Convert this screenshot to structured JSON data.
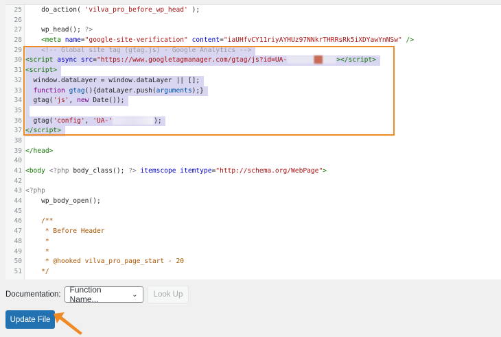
{
  "editor": {
    "lines": [
      {
        "n": "25",
        "sel": false,
        "tokens": [
          [
            "",
            "    do_action( "
          ],
          [
            "str",
            "'vilva_pro_before_wp_head'"
          ],
          [
            "",
            " );"
          ]
        ]
      },
      {
        "n": "26",
        "sel": false,
        "tokens": []
      },
      {
        "n": "27",
        "sel": false,
        "tokens": [
          [
            "",
            "    wp_head(); "
          ],
          [
            "php",
            "?>"
          ]
        ]
      },
      {
        "n": "28",
        "sel": false,
        "tokens": [
          [
            "",
            "    "
          ],
          [
            "tag",
            "<meta "
          ],
          [
            "attr",
            "name"
          ],
          [
            "",
            "="
          ],
          [
            "str",
            "\"google-site-verification\""
          ],
          [
            "",
            " "
          ],
          [
            "attr",
            "content"
          ],
          [
            "",
            "="
          ],
          [
            "str",
            "\"iaUHfvCY11riyAYHUz97NNkrTHRRsRk5iXDYawYnNSw\""
          ],
          [
            "tag",
            " />"
          ]
        ]
      },
      {
        "n": "29",
        "sel": true,
        "tokens": [
          [
            "com",
            "    <!-- Global site tag (gtag.js) - Google Analytics -->"
          ]
        ]
      },
      {
        "n": "30",
        "sel": true,
        "tokens": [
          [
            "tag",
            "<script "
          ],
          [
            "attr",
            "async src"
          ],
          [
            "",
            "="
          ],
          [
            "str",
            "\"https://www.googletagmanager.com/gtag/js?id=UA-"
          ],
          [
            "blur-red",
            ""
          ],
          [
            "tag",
            "></script>"
          ]
        ]
      },
      {
        "n": "31",
        "sel": true,
        "tokens": [
          [
            "tag",
            "<script>"
          ]
        ]
      },
      {
        "n": "32",
        "sel": true,
        "tokens": [
          [
            "",
            "  window.dataLayer = window.dataLayer || [];"
          ]
        ]
      },
      {
        "n": "33",
        "sel": true,
        "tokens": [
          [
            "",
            "  "
          ],
          [
            "kw",
            "function"
          ],
          [
            "",
            " "
          ],
          [
            "var",
            "gtag"
          ],
          [
            "",
            "(){dataLayer.push("
          ],
          [
            "var",
            "arguments"
          ],
          [
            "",
            ");}"
          ]
        ]
      },
      {
        "n": "34",
        "sel": true,
        "tokens": [
          [
            "",
            "  gtag("
          ],
          [
            "str",
            "'js'"
          ],
          [
            "",
            ", "
          ],
          [
            "kw",
            "new"
          ],
          [
            "",
            " Date());"
          ]
        ]
      },
      {
        "n": "35",
        "sel": true,
        "tokens": [
          [
            "",
            ""
          ]
        ]
      },
      {
        "n": "36",
        "sel": true,
        "tokens": [
          [
            "",
            "  gtag("
          ],
          [
            "str",
            "'config'"
          ],
          [
            "",
            ", "
          ],
          [
            "str",
            "'UA-'"
          ],
          [
            "blur",
            ""
          ],
          [
            "",
            ");"
          ]
        ]
      },
      {
        "n": "37",
        "sel": true,
        "tokens": [
          [
            "tag",
            "</script>"
          ]
        ]
      },
      {
        "n": "38",
        "sel": false,
        "tokens": []
      },
      {
        "n": "39",
        "sel": false,
        "tokens": [
          [
            "tag",
            "</head>"
          ]
        ]
      },
      {
        "n": "40",
        "sel": false,
        "tokens": []
      },
      {
        "n": "41",
        "sel": false,
        "tokens": [
          [
            "tag",
            "<body "
          ],
          [
            "php",
            "<?php"
          ],
          [
            "",
            " body_class(); "
          ],
          [
            "php",
            "?>"
          ],
          [
            "",
            " "
          ],
          [
            "attr",
            "itemscope itemtype"
          ],
          [
            "",
            "="
          ],
          [
            "str",
            "\"http://schema.org/WebPage\""
          ],
          [
            "tag",
            ">"
          ]
        ]
      },
      {
        "n": "42",
        "sel": false,
        "tokens": []
      },
      {
        "n": "43",
        "sel": false,
        "tokens": [
          [
            "php",
            "<?php"
          ]
        ]
      },
      {
        "n": "44",
        "sel": false,
        "tokens": [
          [
            "",
            "    wp_body_open();"
          ]
        ]
      },
      {
        "n": "45",
        "sel": false,
        "tokens": []
      },
      {
        "n": "46",
        "sel": false,
        "tokens": [
          [
            "doc",
            "    /**"
          ]
        ]
      },
      {
        "n": "47",
        "sel": false,
        "tokens": [
          [
            "doc",
            "     * Before Header"
          ]
        ]
      },
      {
        "n": "48",
        "sel": false,
        "tokens": [
          [
            "doc",
            "     *"
          ]
        ]
      },
      {
        "n": "49",
        "sel": false,
        "tokens": [
          [
            "doc",
            "     *"
          ]
        ]
      },
      {
        "n": "50",
        "sel": false,
        "tokens": [
          [
            "doc",
            "     * @hooked vilva_pro_page_start - 20"
          ]
        ]
      },
      {
        "n": "51",
        "sel": false,
        "tokens": [
          [
            "doc",
            "    */"
          ]
        ]
      }
    ]
  },
  "documentation": {
    "label": "Documentation:",
    "select_value": "Function Name...",
    "lookup_label": "Look Up"
  },
  "update_label": "Update File",
  "colors": {
    "highlight_box": "#f08a24",
    "primary_button": "#2271b1"
  }
}
